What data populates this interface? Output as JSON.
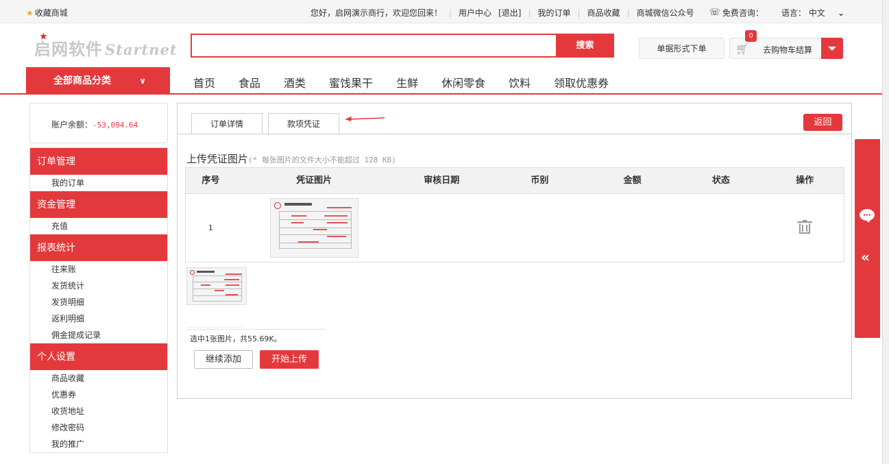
{
  "topbar": {
    "favorite": "收藏商城",
    "greeting": "您好，启网演示商行，欢迎您回来！",
    "user_center": "用户中心",
    "logout": "[退出]",
    "my_orders": "我的订单",
    "product_favorites": "商品收藏",
    "wechat": "商城微信公众号",
    "free_consult": "免费咨询：",
    "language_label": "语言：",
    "language_value": "中文"
  },
  "logo": {
    "cn": "启网软件",
    "en": "Startnet"
  },
  "search": {
    "placeholder": "",
    "button": "搜索"
  },
  "header": {
    "order_form_button": "单据形式下单",
    "cart_label": "去购物车结算",
    "cart_count": "0"
  },
  "nav": {
    "all_categories": "全部商品分类",
    "items": [
      "首页",
      "食品",
      "酒类",
      "蜜饯果干",
      "生鲜",
      "休闲零食",
      "饮料",
      "领取优惠券"
    ]
  },
  "sidebar": {
    "balance_label": "账户余额：",
    "balance_value": "-53,094.64",
    "groups": [
      {
        "title": "订单管理",
        "items": [
          "我的订单"
        ]
      },
      {
        "title": "资金管理",
        "items": [
          "充值"
        ]
      },
      {
        "title": "报表统计",
        "items": [
          "往来账",
          "发货统计",
          "发货明细",
          "返利明细",
          "佣金提成记录"
        ]
      },
      {
        "title": "个人设置",
        "items": [
          "商品收藏",
          "优惠券",
          "收货地址",
          "修改密码",
          "我的推广"
        ]
      }
    ]
  },
  "main": {
    "tabs": [
      "订单详情",
      "款项凭证"
    ],
    "back_button": "返回",
    "upload_title": "上传凭证图片",
    "upload_note": "(* 每张图片的文件大小不能超过 128 KB)",
    "table": {
      "headers": [
        "序号",
        "凭证图片",
        "审核日期",
        "币别",
        "金额",
        "状态",
        "操作"
      ],
      "rows": [
        {
          "index": "1",
          "audit_date": "",
          "currency": "",
          "amount": "",
          "status": ""
        }
      ]
    },
    "selected_info": "选中1张图片，共55.69K。",
    "continue_button": "继续添加",
    "start_upload_button": "开始上传"
  },
  "colors": {
    "accent": "#e4393c",
    "balance": "#e4393c"
  }
}
